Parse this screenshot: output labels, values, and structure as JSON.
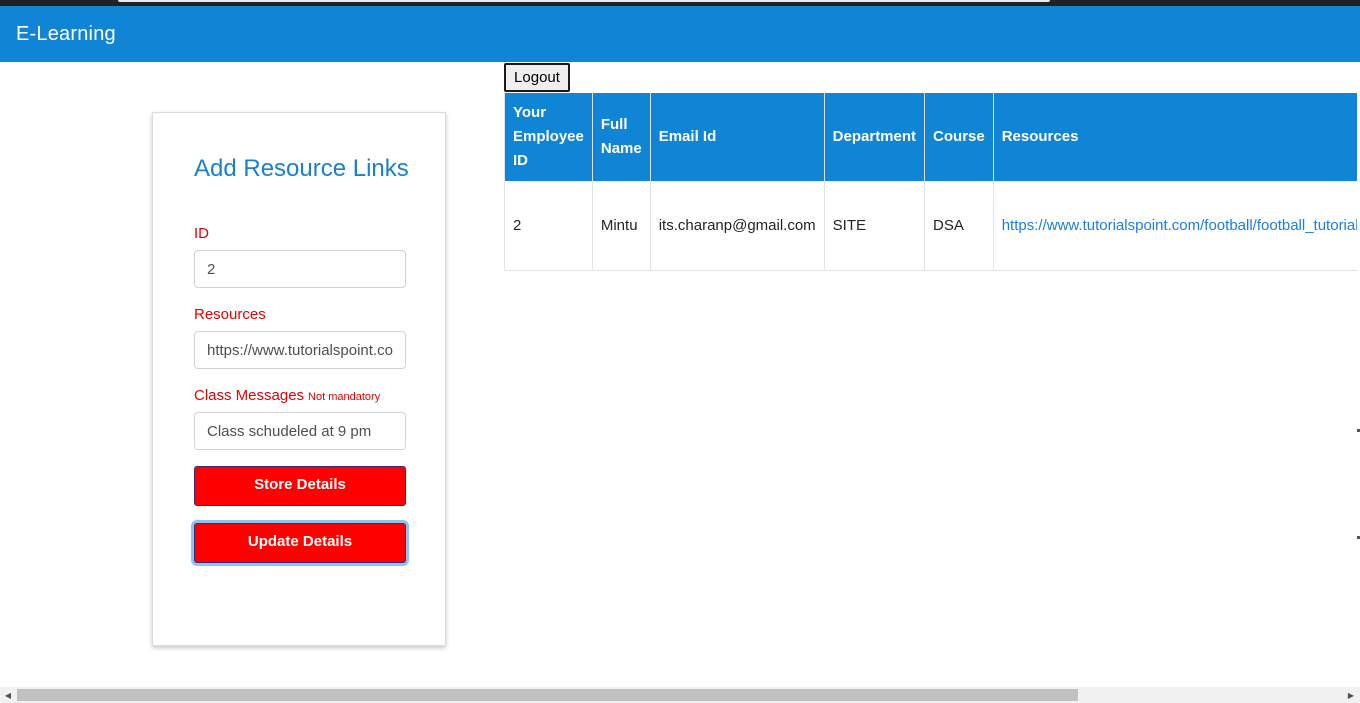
{
  "navbar": {
    "brand": "E-Learning"
  },
  "form": {
    "title": "Add Resource Links",
    "id_label": "ID",
    "id_value": "2",
    "resources_label": "Resources",
    "resources_value": "https://www.tutorialspoint.com/football/football_tutorial.pdf",
    "messages_label": "Class Messages",
    "messages_note": "Not mandatory",
    "messages_value": "Class schudeled at 9 pm",
    "store_button": "Store Details",
    "update_button": "Update Details"
  },
  "logout_label": "Logout",
  "table": {
    "headers": [
      "Your Employee ID",
      "Full Name",
      "Email Id",
      "Department",
      "Course",
      "Resources"
    ],
    "rows": [
      [
        "2",
        "Mintu",
        "its.charanp@gmail.com",
        "SITE",
        "DSA",
        "https://www.tutorialspoint.com/football/football_tutorial.pdf"
      ]
    ]
  },
  "colors": {
    "primary": "#1185d5",
    "accent": "#ff0000",
    "label": "#e60000",
    "link": "#1a7fe0"
  },
  "icons": {
    "scroll_left": "scroll-left-arrow-icon",
    "scroll_right": "scroll-right-arrow-icon"
  }
}
